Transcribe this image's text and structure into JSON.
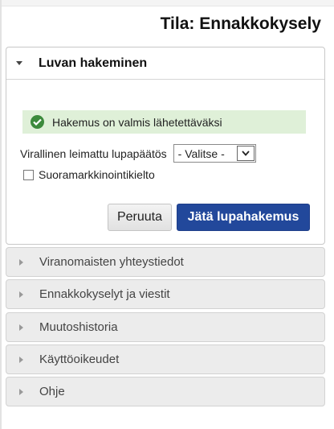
{
  "status_title": "Tila: Ennakkokysely",
  "application_panel": {
    "title": "Luvan hakeminen",
    "success_message": "Hakemus on valmis lähetettäväksi",
    "decision_label": "Virallinen leimattu lupapäätös",
    "decision_select_value": "- Valitse -",
    "direct_marketing_label": "Suoramarkkinointikielto",
    "direct_marketing_checked": false,
    "cancel_label": "Peruuta",
    "submit_label": "Jätä lupahakemus"
  },
  "accordion_items": [
    {
      "label": "Viranomaisten yhteystiedot"
    },
    {
      "label": "Ennakkokyselyt ja viestit"
    },
    {
      "label": "Muutoshistoria"
    },
    {
      "label": "Käyttöoikeudet"
    },
    {
      "label": "Ohje"
    }
  ],
  "colors": {
    "success_bg": "#dff0d8",
    "success_icon": "#3c8a3c",
    "primary_button": "#22489b",
    "accordion_bg": "#ececec"
  },
  "icons": {
    "panel_expanded": "caret-down-icon",
    "panel_collapsed": "caret-right-icon",
    "success": "check-circle-icon",
    "select": "chevron-down-icon"
  }
}
